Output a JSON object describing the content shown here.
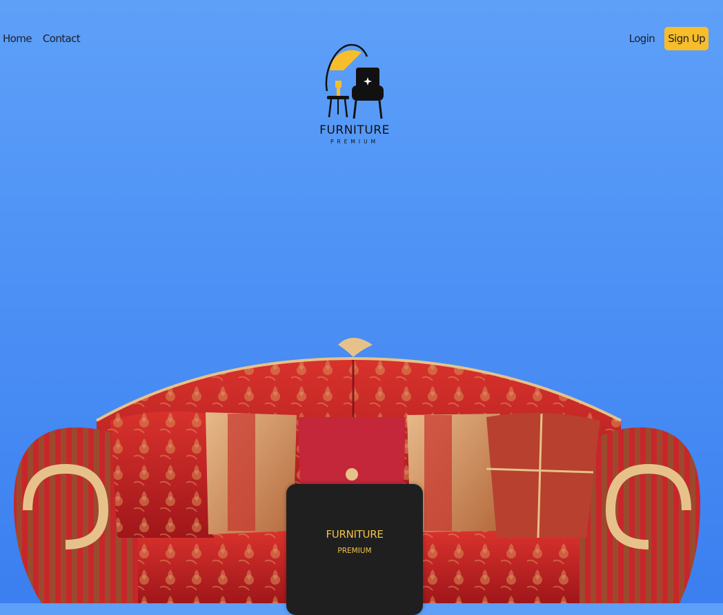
{
  "nav": {
    "home": "Home",
    "contact": "Contact",
    "login": "Login",
    "signup": "Sign Up"
  },
  "logo": {
    "title": "FURNITURE",
    "subtitle": "PREMIUM",
    "icon": "armchair-lamp-logo-icon"
  },
  "hero": {
    "image": "red-gold-baroque-sofa",
    "card": {
      "title": "FURNITURE",
      "subtitle": "PREMIUM"
    }
  },
  "colors": {
    "background_top": "#5ea0f8",
    "background_bottom": "#3b7ff0",
    "accent": "#f7bd2a",
    "card": "#1f1f1f",
    "card_text": "#f2c34b"
  }
}
